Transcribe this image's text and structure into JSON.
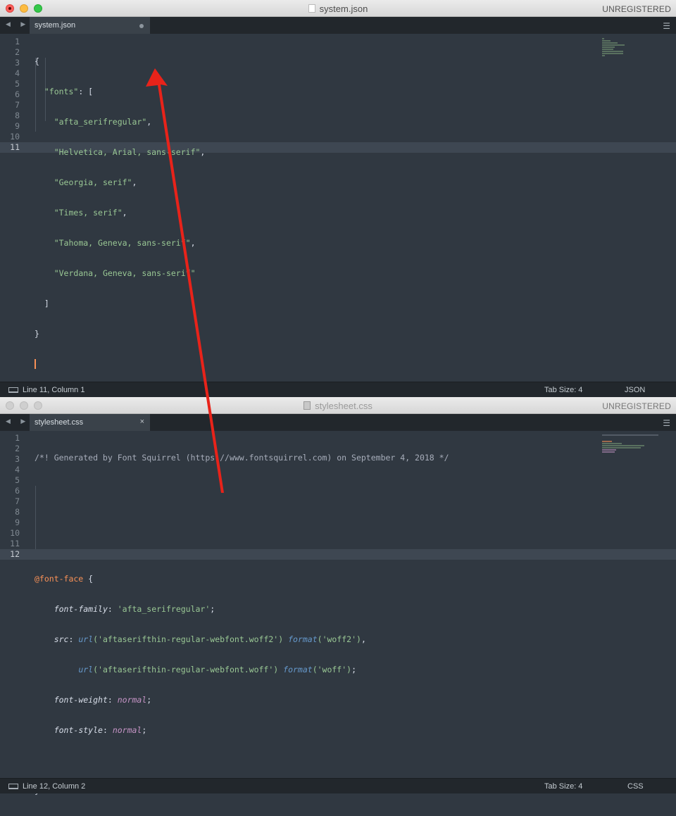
{
  "top_window": {
    "title": "system.json",
    "unregistered": "UNREGISTERED",
    "nav": "◀ ▶",
    "tab_label": "system.json",
    "menu_icon": "☰",
    "line_numbers": [
      "1",
      "2",
      "3",
      "4",
      "5",
      "6",
      "7",
      "8",
      "9",
      "10",
      "11"
    ],
    "status_left": "Line 11, Column 1",
    "status_tab": "Tab Size: 4",
    "status_syntax": "JSON"
  },
  "bottom_window": {
    "title": "stylesheet.css",
    "unregistered": "UNREGISTERED",
    "nav": "◀ ▶",
    "tab_label": "stylesheet.css",
    "tab_close": "×",
    "menu_icon": "☰",
    "line_numbers": [
      "1",
      "2",
      "3",
      "4",
      "5",
      "6",
      "7",
      "8",
      "9",
      "10",
      "11",
      "12"
    ],
    "status_left": "Line 12, Column 2",
    "status_tab": "Tab Size: 4",
    "status_syntax": "CSS"
  },
  "json_code": {
    "l1": "{",
    "l2_key": "\"fonts\"",
    "l2_rest": ": [",
    "fonts": [
      "\"afta_serifregular\"",
      "\"Helvetica, Arial, sans-serif\"",
      "\"Georgia, serif\"",
      "\"Times, serif\"",
      "\"Tahoma, Geneva, sans-serif\"",
      "\"Verdana, Geneva, sans-serif\""
    ],
    "comma": ",",
    "l9": "]",
    "l10": "}"
  },
  "css_code": {
    "comment": "/*! Generated by Font Squirrel (https://www.fontsquirrel.com) on September 4, 2018 */",
    "at_rule": "@font-face",
    "open_brace": " {",
    "font_family_prop": "font-family",
    "font_family_val": "'afta_serifregular'",
    "src_prop": "src",
    "url_fn": "url",
    "woff2_file": "('aftaserifthin-regular-webfont.woff2')",
    "format_fn": "format",
    "woff2_fmt": "('woff2')",
    "woff_file": "('aftaserifthin-regular-webfont.woff')",
    "woff_fmt": "('woff')",
    "font_weight_prop": "font-weight",
    "font_style_prop": "font-style",
    "normal": "normal",
    "close_brace": "}"
  },
  "annotation": {
    "arrow_color": "#e8231a"
  }
}
